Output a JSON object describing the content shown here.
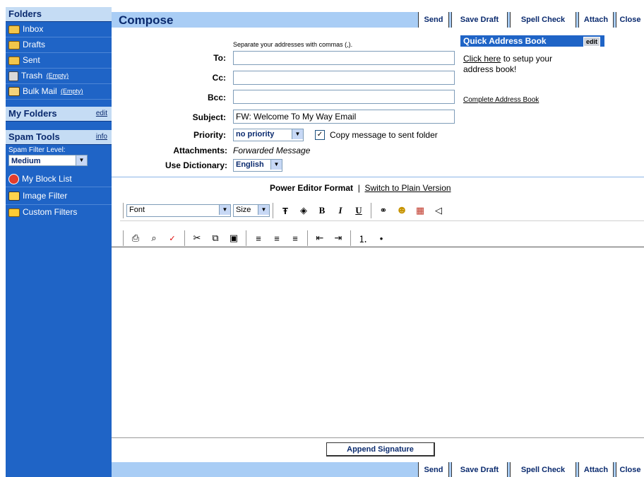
{
  "sidebar": {
    "folders_heading": "Folders",
    "folders": [
      {
        "label": "Inbox",
        "icon": "inbox-icon"
      },
      {
        "label": "Drafts",
        "icon": "drafts-icon"
      },
      {
        "label": "Sent",
        "icon": "sent-icon"
      },
      {
        "label": "Trash",
        "icon": "trash-icon",
        "extra": "(Empty)"
      },
      {
        "label": "Bulk Mail",
        "icon": "bulk-mail-icon",
        "extra": "(Empty)"
      }
    ],
    "my_folders_heading": "My Folders",
    "my_folders_link": "edit",
    "spam_tools_heading": "Spam Tools",
    "spam_tools_link": "info",
    "spam_filter_label": "Spam Filter Level:",
    "spam_filter_value": "Medium",
    "tools": [
      {
        "label": "My Block List",
        "icon": "block-list-icon"
      },
      {
        "label": "Image Filter",
        "icon": "image-filter-icon"
      },
      {
        "label": "Custom Filters",
        "icon": "custom-filters-icon"
      }
    ]
  },
  "header": {
    "title": "Compose",
    "buttons": [
      "Send",
      "Save Draft",
      "Spell Check",
      "Attach",
      "Close"
    ]
  },
  "form": {
    "hint": "Separate your addresses with commas (,).",
    "to_label": "To:",
    "to_value": "",
    "cc_label": "Cc:",
    "cc_value": "",
    "bcc_label": "Bcc:",
    "bcc_value": "",
    "subject_label": "Subject:",
    "subject_value": "FW: Welcome To My Way Email",
    "priority_label": "Priority:",
    "priority_value": "no priority",
    "copy_label": "Copy message to sent folder",
    "copy_checked": true,
    "attachments_label": "Attachments:",
    "attachments_value": "Forwarded Message",
    "dictionary_label": "Use Dictionary:",
    "dictionary_value": "English"
  },
  "address_book": {
    "title": "Quick Address Book",
    "edit": "edit",
    "setup_link": "Click here",
    "setup_text": "to setup your address book!",
    "complete_link": "Complete Address Book"
  },
  "editor": {
    "format_label": "Power Editor Format",
    "divider": "|",
    "switch_link": "Switch to Plain Version",
    "font_value": "Font",
    "size_value": "Size",
    "append_signature": "Append Signature"
  },
  "colors": {
    "sidebar_bg": "#1f64c6",
    "bar_bg": "#a9cdf5",
    "title": "#0a2a6e"
  }
}
